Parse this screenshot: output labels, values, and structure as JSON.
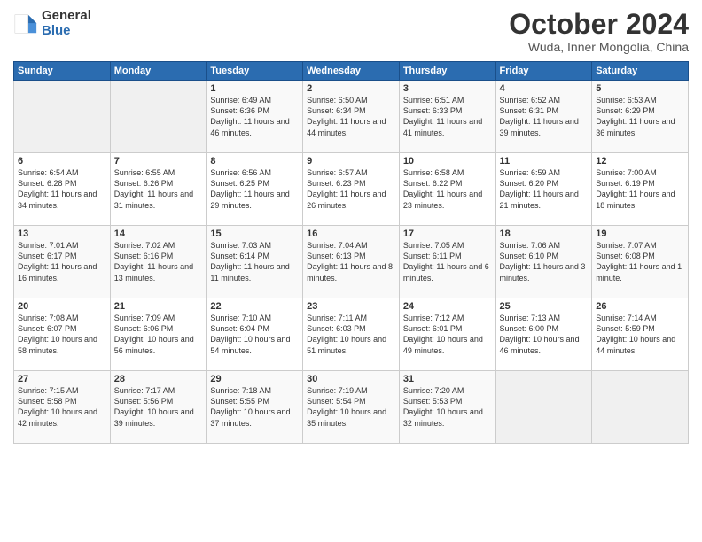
{
  "logo": {
    "general": "General",
    "blue": "Blue"
  },
  "title": "October 2024",
  "location": "Wuda, Inner Mongolia, China",
  "headers": [
    "Sunday",
    "Monday",
    "Tuesday",
    "Wednesday",
    "Thursday",
    "Friday",
    "Saturday"
  ],
  "weeks": [
    [
      {
        "day": "",
        "sunrise": "",
        "sunset": "",
        "daylight": ""
      },
      {
        "day": "",
        "sunrise": "",
        "sunset": "",
        "daylight": ""
      },
      {
        "day": "1",
        "sunrise": "Sunrise: 6:49 AM",
        "sunset": "Sunset: 6:36 PM",
        "daylight": "Daylight: 11 hours and 46 minutes."
      },
      {
        "day": "2",
        "sunrise": "Sunrise: 6:50 AM",
        "sunset": "Sunset: 6:34 PM",
        "daylight": "Daylight: 11 hours and 44 minutes."
      },
      {
        "day": "3",
        "sunrise": "Sunrise: 6:51 AM",
        "sunset": "Sunset: 6:33 PM",
        "daylight": "Daylight: 11 hours and 41 minutes."
      },
      {
        "day": "4",
        "sunrise": "Sunrise: 6:52 AM",
        "sunset": "Sunset: 6:31 PM",
        "daylight": "Daylight: 11 hours and 39 minutes."
      },
      {
        "day": "5",
        "sunrise": "Sunrise: 6:53 AM",
        "sunset": "Sunset: 6:29 PM",
        "daylight": "Daylight: 11 hours and 36 minutes."
      }
    ],
    [
      {
        "day": "6",
        "sunrise": "Sunrise: 6:54 AM",
        "sunset": "Sunset: 6:28 PM",
        "daylight": "Daylight: 11 hours and 34 minutes."
      },
      {
        "day": "7",
        "sunrise": "Sunrise: 6:55 AM",
        "sunset": "Sunset: 6:26 PM",
        "daylight": "Daylight: 11 hours and 31 minutes."
      },
      {
        "day": "8",
        "sunrise": "Sunrise: 6:56 AM",
        "sunset": "Sunset: 6:25 PM",
        "daylight": "Daylight: 11 hours and 29 minutes."
      },
      {
        "day": "9",
        "sunrise": "Sunrise: 6:57 AM",
        "sunset": "Sunset: 6:23 PM",
        "daylight": "Daylight: 11 hours and 26 minutes."
      },
      {
        "day": "10",
        "sunrise": "Sunrise: 6:58 AM",
        "sunset": "Sunset: 6:22 PM",
        "daylight": "Daylight: 11 hours and 23 minutes."
      },
      {
        "day": "11",
        "sunrise": "Sunrise: 6:59 AM",
        "sunset": "Sunset: 6:20 PM",
        "daylight": "Daylight: 11 hours and 21 minutes."
      },
      {
        "day": "12",
        "sunrise": "Sunrise: 7:00 AM",
        "sunset": "Sunset: 6:19 PM",
        "daylight": "Daylight: 11 hours and 18 minutes."
      }
    ],
    [
      {
        "day": "13",
        "sunrise": "Sunrise: 7:01 AM",
        "sunset": "Sunset: 6:17 PM",
        "daylight": "Daylight: 11 hours and 16 minutes."
      },
      {
        "day": "14",
        "sunrise": "Sunrise: 7:02 AM",
        "sunset": "Sunset: 6:16 PM",
        "daylight": "Daylight: 11 hours and 13 minutes."
      },
      {
        "day": "15",
        "sunrise": "Sunrise: 7:03 AM",
        "sunset": "Sunset: 6:14 PM",
        "daylight": "Daylight: 11 hours and 11 minutes."
      },
      {
        "day": "16",
        "sunrise": "Sunrise: 7:04 AM",
        "sunset": "Sunset: 6:13 PM",
        "daylight": "Daylight: 11 hours and 8 minutes."
      },
      {
        "day": "17",
        "sunrise": "Sunrise: 7:05 AM",
        "sunset": "Sunset: 6:11 PM",
        "daylight": "Daylight: 11 hours and 6 minutes."
      },
      {
        "day": "18",
        "sunrise": "Sunrise: 7:06 AM",
        "sunset": "Sunset: 6:10 PM",
        "daylight": "Daylight: 11 hours and 3 minutes."
      },
      {
        "day": "19",
        "sunrise": "Sunrise: 7:07 AM",
        "sunset": "Sunset: 6:08 PM",
        "daylight": "Daylight: 11 hours and 1 minute."
      }
    ],
    [
      {
        "day": "20",
        "sunrise": "Sunrise: 7:08 AM",
        "sunset": "Sunset: 6:07 PM",
        "daylight": "Daylight: 10 hours and 58 minutes."
      },
      {
        "day": "21",
        "sunrise": "Sunrise: 7:09 AM",
        "sunset": "Sunset: 6:06 PM",
        "daylight": "Daylight: 10 hours and 56 minutes."
      },
      {
        "day": "22",
        "sunrise": "Sunrise: 7:10 AM",
        "sunset": "Sunset: 6:04 PM",
        "daylight": "Daylight: 10 hours and 54 minutes."
      },
      {
        "day": "23",
        "sunrise": "Sunrise: 7:11 AM",
        "sunset": "Sunset: 6:03 PM",
        "daylight": "Daylight: 10 hours and 51 minutes."
      },
      {
        "day": "24",
        "sunrise": "Sunrise: 7:12 AM",
        "sunset": "Sunset: 6:01 PM",
        "daylight": "Daylight: 10 hours and 49 minutes."
      },
      {
        "day": "25",
        "sunrise": "Sunrise: 7:13 AM",
        "sunset": "Sunset: 6:00 PM",
        "daylight": "Daylight: 10 hours and 46 minutes."
      },
      {
        "day": "26",
        "sunrise": "Sunrise: 7:14 AM",
        "sunset": "Sunset: 5:59 PM",
        "daylight": "Daylight: 10 hours and 44 minutes."
      }
    ],
    [
      {
        "day": "27",
        "sunrise": "Sunrise: 7:15 AM",
        "sunset": "Sunset: 5:58 PM",
        "daylight": "Daylight: 10 hours and 42 minutes."
      },
      {
        "day": "28",
        "sunrise": "Sunrise: 7:17 AM",
        "sunset": "Sunset: 5:56 PM",
        "daylight": "Daylight: 10 hours and 39 minutes."
      },
      {
        "day": "29",
        "sunrise": "Sunrise: 7:18 AM",
        "sunset": "Sunset: 5:55 PM",
        "daylight": "Daylight: 10 hours and 37 minutes."
      },
      {
        "day": "30",
        "sunrise": "Sunrise: 7:19 AM",
        "sunset": "Sunset: 5:54 PM",
        "daylight": "Daylight: 10 hours and 35 minutes."
      },
      {
        "day": "31",
        "sunrise": "Sunrise: 7:20 AM",
        "sunset": "Sunset: 5:53 PM",
        "daylight": "Daylight: 10 hours and 32 minutes."
      },
      {
        "day": "",
        "sunrise": "",
        "sunset": "",
        "daylight": ""
      },
      {
        "day": "",
        "sunrise": "",
        "sunset": "",
        "daylight": ""
      }
    ]
  ]
}
